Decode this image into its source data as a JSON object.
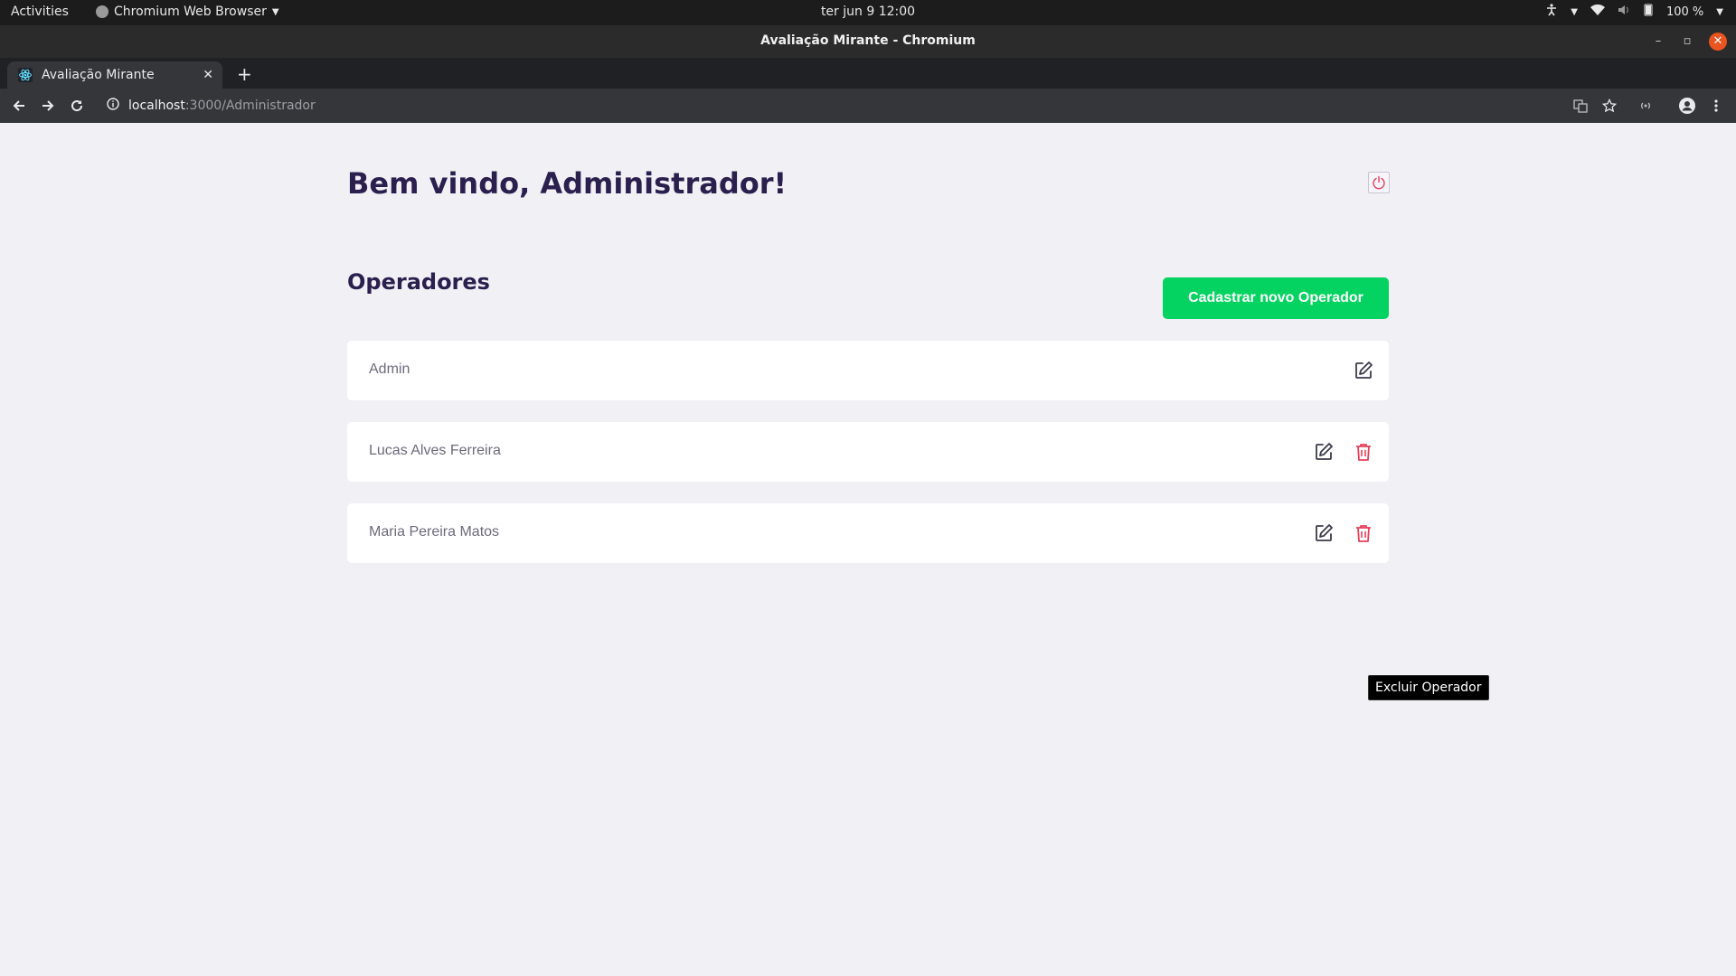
{
  "os_bar": {
    "activities": "Activities",
    "app_menu": "Chromium Web Browser",
    "clock": "ter jun 9  12:00",
    "battery": "100 %",
    "icons": [
      "accessibility-icon",
      "wifi-icon",
      "volume-icon",
      "battery-icon"
    ]
  },
  "window": {
    "title": "Avaliação Mirante - Chromium"
  },
  "browser": {
    "tab_title": "Avaliação Mirante",
    "url_host": "localhost",
    "url_path": ":3000/Administrador"
  },
  "page": {
    "welcome": "Bem vindo, Administrador!",
    "section_title": "Operadores",
    "add_button": "Cadastrar novo Operador",
    "operators": [
      {
        "name": "Admin",
        "deletable": false
      },
      {
        "name": "Lucas Alves Ferreira",
        "deletable": true
      },
      {
        "name": "Maria Pereira Matos",
        "deletable": true
      }
    ],
    "tooltip": "Excluir Operador"
  },
  "colors": {
    "accent_green": "#04d361",
    "heading": "#2a1f4d",
    "delete_red": "#e83f5b"
  }
}
